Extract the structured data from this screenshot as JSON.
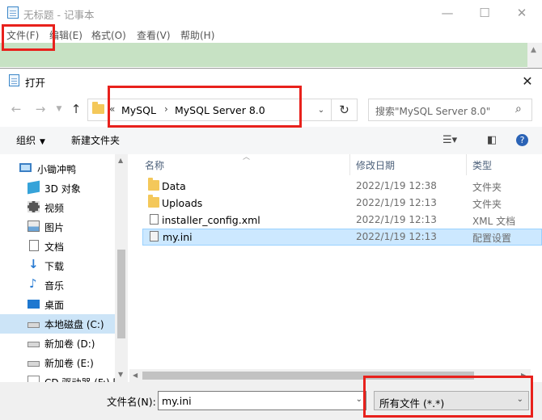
{
  "notepad": {
    "title": "无标题 - 记事本",
    "menu": [
      "文件(F)",
      "编辑(E)",
      "格式(O)",
      "查看(V)",
      "帮助(H)"
    ],
    "window_buttons": {
      "minimize": "—",
      "maximize": "☐",
      "close": "✕"
    }
  },
  "dialog": {
    "title": "打开",
    "address": {
      "overflow": "«",
      "crumbs": [
        "MySQL",
        "MySQL Server 8.0"
      ],
      "separator": "›"
    },
    "search_placeholder": "搜索\"MySQL Server 8.0\"",
    "toolbar": {
      "organize": "组织",
      "new_folder": "新建文件夹"
    },
    "nav_items": [
      {
        "label": "小锄冲鸭",
        "icon": "pc-icon"
      },
      {
        "label": "3D 对象",
        "icon": "3d-objects-icon"
      },
      {
        "label": "视频",
        "icon": "video-icon"
      },
      {
        "label": "图片",
        "icon": "pictures-icon"
      },
      {
        "label": "文档",
        "icon": "documents-icon"
      },
      {
        "label": "下载",
        "icon": "download-icon"
      },
      {
        "label": "音乐",
        "icon": "music-icon"
      },
      {
        "label": "桌面",
        "icon": "desktop-icon"
      },
      {
        "label": "本地磁盘 (C:)",
        "icon": "drive-icon"
      },
      {
        "label": "新加卷 (D:)",
        "icon": "drive-icon"
      },
      {
        "label": "新加卷 (E:)",
        "icon": "drive-icon"
      },
      {
        "label": "CD 驱动器 (F:) [",
        "icon": "cd-drive-icon"
      }
    ],
    "columns": {
      "name": "名称",
      "date": "修改日期",
      "type": "类型"
    },
    "files": [
      {
        "name": "Data",
        "date": "2022/1/19 12:38",
        "type": "文件夹",
        "icon": "folder-icon"
      },
      {
        "name": "Uploads",
        "date": "2022/1/19 12:13",
        "type": "文件夹",
        "icon": "folder-icon"
      },
      {
        "name": "installer_config.xml",
        "date": "2022/1/19 12:13",
        "type": "XML 文档",
        "icon": "xml-file-icon"
      },
      {
        "name": "my.ini",
        "date": "2022/1/19 12:13",
        "type": "配置设置",
        "icon": "config-file-icon"
      }
    ],
    "filename_label": "文件名(N):",
    "filename_value": "my.ini",
    "filetype_value": "所有文件 (*.*)"
  },
  "colors": {
    "highlight": "#e8211c",
    "editor_bg": "#c7e2c4",
    "selection": "#cce8ff",
    "folder": "#f4c85a"
  }
}
